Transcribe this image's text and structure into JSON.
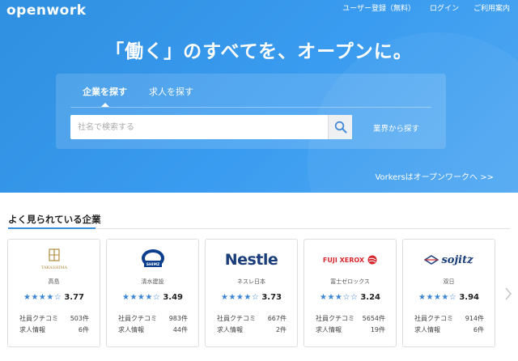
{
  "brand": {
    "logo_text": "openwork"
  },
  "nav": {
    "items": [
      "ユーザー登録（無料）",
      "ログイン",
      "ご利用案内"
    ]
  },
  "hero": {
    "headline": "「働く」のすべてを、オープンに。"
  },
  "search": {
    "tabs": [
      {
        "label": "企業を探す",
        "active": true
      },
      {
        "label": "求人を探す",
        "active": false
      }
    ],
    "placeholder": "社名で検索する",
    "value": "",
    "industry_link": "業界から探す"
  },
  "vorkers_link": "Vorkersはオープンワークへ >>",
  "popular": {
    "title": "よく見られている企業",
    "stat_labels": {
      "reviews": "社員クチコミ",
      "jobs": "求人情報"
    },
    "companies": [
      {
        "name": "高島",
        "logo_text": "TAKASHIMA",
        "rating": "3.77",
        "stars": "★★★★☆",
        "reviews": "503件",
        "jobs": "6件"
      },
      {
        "name": "清水建設",
        "logo_text": "SHIMZ",
        "rating": "3.49",
        "stars": "★★★★☆",
        "reviews": "983件",
        "jobs": "44件"
      },
      {
        "name": "ネスレ日本",
        "logo_text": "Nestle",
        "rating": "3.73",
        "stars": "★★★★☆",
        "reviews": "667件",
        "jobs": "2件"
      },
      {
        "name": "富士ゼロックス",
        "logo_text": "FUJI XEROX",
        "rating": "3.24",
        "stars": "★★★☆☆",
        "reviews": "5654件",
        "jobs": "19件"
      },
      {
        "name": "双日",
        "logo_text": "sojitz",
        "rating": "3.94",
        "stars": "★★★★☆",
        "reviews": "914件",
        "jobs": "6件"
      }
    ]
  },
  "colors": {
    "hero": "#3a9cf0",
    "accent": "#3a84d6",
    "xerox_red": "#d7282f"
  }
}
